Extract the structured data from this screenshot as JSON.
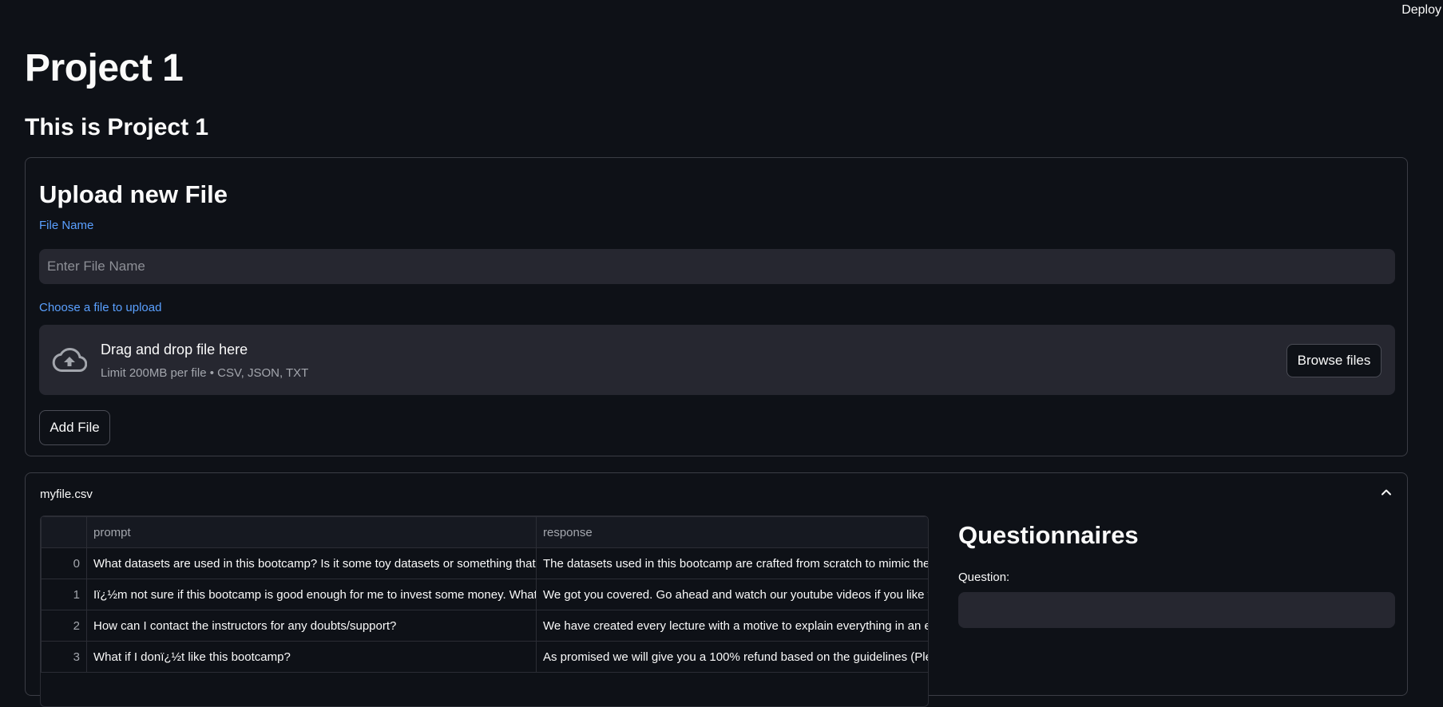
{
  "header": {
    "deploy_label": "Deploy"
  },
  "page": {
    "title": "Project 1",
    "subtitle": "This is Project 1"
  },
  "upload": {
    "heading": "Upload new File",
    "file_name_label": "File Name",
    "file_name_placeholder": "Enter File Name",
    "file_name_value": "",
    "choose_label": "Choose a file to upload",
    "dropzone_title": "Drag and drop file here",
    "dropzone_limit": "Limit 200MB per file • CSV, JSON, TXT",
    "browse_label": "Browse files",
    "add_file_label": "Add File",
    "icon": "cloud-upload-icon"
  },
  "file_panel": {
    "filename": "myfile.csv",
    "collapse_icon": "chevron-up-icon",
    "table": {
      "columns": [
        "",
        "prompt",
        "response"
      ],
      "rows": [
        {
          "index": "0",
          "prompt": "What datasets are used in this bootcamp? Is it some toy datasets or  something that m",
          "response": "The datasets used in this bootcamp are crafted from scratch to mimic the r"
        },
        {
          "index": "1",
          "prompt": "Iï¿½m not sure if this bootcamp is good enough for me to invest some  money. What c",
          "response": "We got you covered. Go ahead and watch our youtube videos if you like the"
        },
        {
          "index": "2",
          "prompt": "How can I contact the instructors for any doubts/support?",
          "response": "We have created every lecture with a motive to explain everything in an ea"
        },
        {
          "index": "3",
          "prompt": "What if I donï¿½t like this bootcamp?",
          "response": "As promised we will give you a 100% refund based on the guidelines (Pleas"
        }
      ]
    },
    "questionnaires": {
      "heading": "Questionnaires",
      "question_label": "Question:",
      "question_value": ""
    }
  },
  "colors": {
    "background": "#0e1117",
    "input_bg": "#262730",
    "label_accent": "#5aa0ff",
    "border": "#3b3d45"
  }
}
